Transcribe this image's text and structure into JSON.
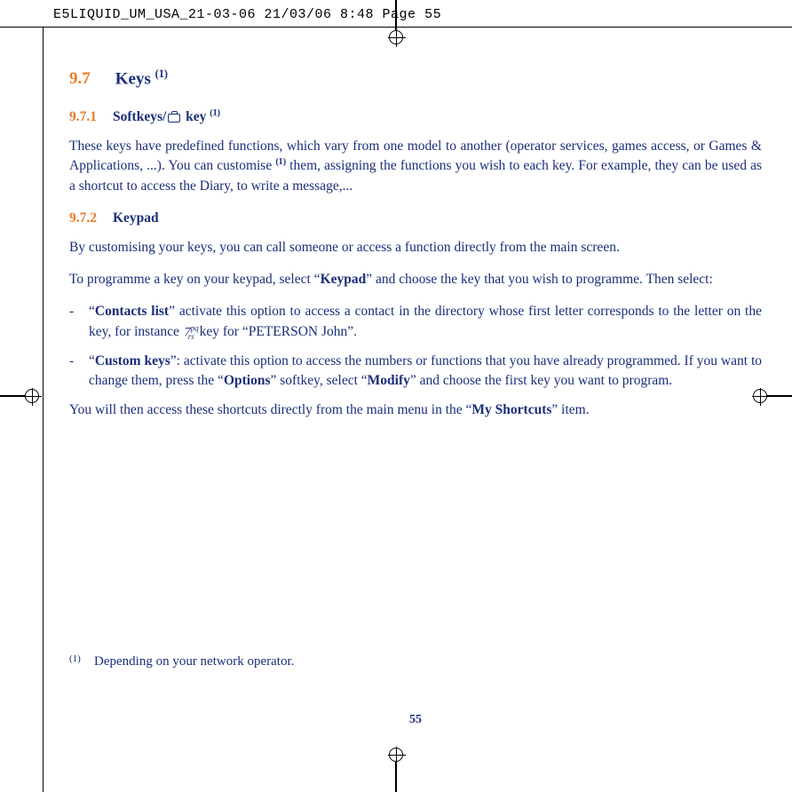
{
  "header": {
    "slug": "E5LIQUID_UM_USA_21-03-06  21/03/06  8:48  Page 55"
  },
  "section": {
    "number": "9.7",
    "title": "Keys",
    "note_mark": "(1)"
  },
  "sub1": {
    "number": "9.7.1",
    "title_prefix": "Softkeys/",
    "title_suffix": " key",
    "note_mark": "(1)",
    "para": "These keys have predefined functions, which vary from one model to another (operator services, games access, or Games & Applications, ...). You can customise",
    "para_after_mark": " them, assigning the functions you wish to each key. For example, they can be used as a shortcut to access the Diary, to write a message,..."
  },
  "sub2": {
    "number": "9.7.2",
    "title": "Keypad",
    "p1": "By customising your keys, you can call someone or access a function directly from the main screen.",
    "p2_a": "To programme a key on your keypad, select “",
    "p2_b": "Keypad",
    "p2_c": "” and choose the key that you wish to programme. Then select:",
    "li1_a": "“",
    "li1_b": "Contacts list",
    "li1_c": "” activate this option to access a contact in the directory whose first letter corresponds to the letter on the key, for instance ",
    "li1_d": " key for “PETERSON John”.",
    "li2_a": "“",
    "li2_b": "Custom keys",
    "li2_c": "”: activate this option to access the numbers or functions that you have already programmed. If you want to change them, press the “",
    "li2_d": "Options",
    "li2_e": "” softkey, select “",
    "li2_f": "Modify",
    "li2_g": "” and choose the first key you want to program.",
    "p3_a": "You will then access these shortcuts directly from the main menu in the “",
    "p3_b": "My Shortcuts",
    "p3_c": "” item."
  },
  "footnote": {
    "mark": "(1)",
    "text": "Depending on your network operator."
  },
  "page_number": "55",
  "key7": {
    "digit": "7",
    "top": "pq",
    "bot": "rs"
  }
}
